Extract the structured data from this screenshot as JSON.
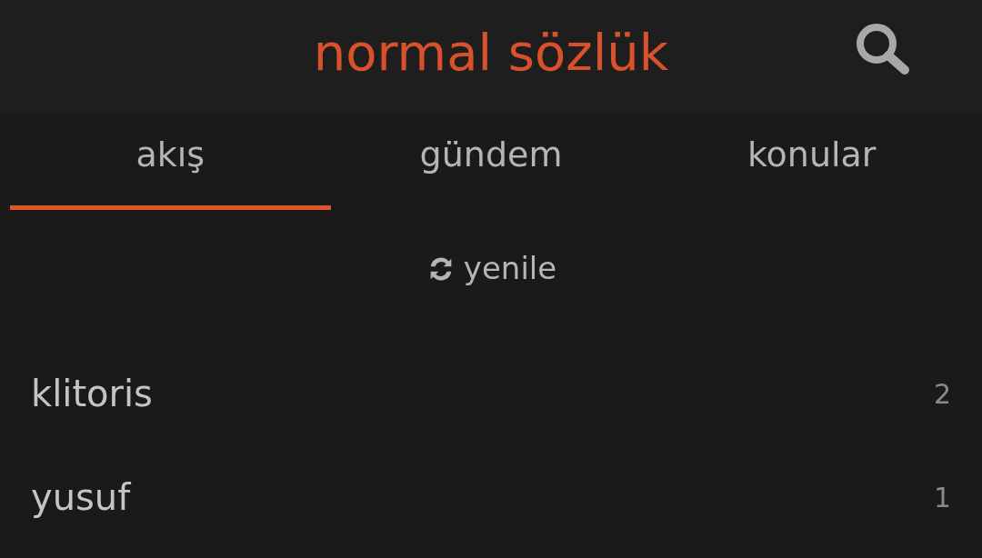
{
  "header": {
    "title": "normal sözlük"
  },
  "tabs": [
    {
      "label": "akış",
      "selected": true
    },
    {
      "label": "gündem",
      "selected": false
    },
    {
      "label": "konular",
      "selected": false
    }
  ],
  "refresh": {
    "label": "yenile"
  },
  "entries": [
    {
      "title": "klitoris",
      "count": "2"
    },
    {
      "title": "yusuf",
      "count": "1"
    }
  ]
}
